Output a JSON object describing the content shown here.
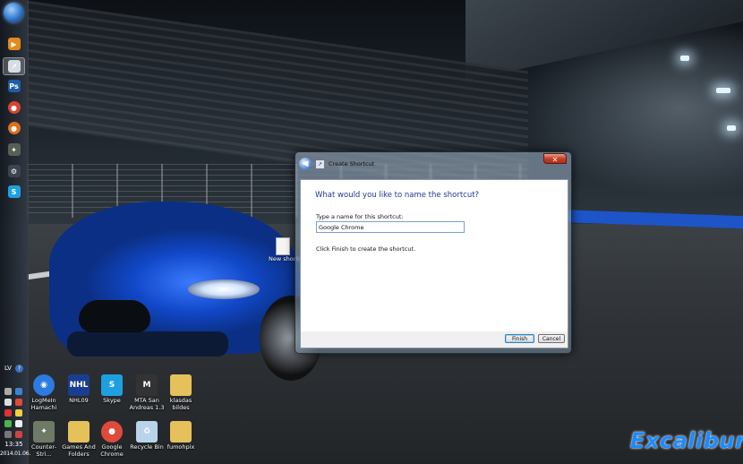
{
  "desktop": {
    "brand_text": "Excalibur",
    "icons": [
      {
        "label": "LogMeIn Hamachi",
        "icon": "hamachi-icon",
        "color": "#2b7be0"
      },
      {
        "label": "NHL09",
        "icon": "nhl09-icon",
        "color": "#1a3d8f"
      },
      {
        "label": "Skype",
        "icon": "skype-icon",
        "color": "#1ea0e0"
      },
      {
        "label": "MTA San Andreas 1.3",
        "icon": "mta-icon",
        "color": "#333333"
      },
      {
        "label": "klasdas bildes",
        "icon": "folder-icon",
        "color": "#e4c15a"
      },
      {
        "label": "Counter-Stri...",
        "icon": "counter-strike-icon",
        "color": "#6f7a66"
      },
      {
        "label": "Games And Folders",
        "icon": "folder-icon",
        "color": "#e4c15a"
      },
      {
        "label": "Google Chrome",
        "icon": "chrome-icon",
        "color": "#e04a3a"
      },
      {
        "label": "Recycle Bin",
        "icon": "recycle-bin-icon",
        "color": "#b9d4ea"
      },
      {
        "label": "fumohpix",
        "icon": "folder-icon",
        "color": "#e4c15a"
      }
    ],
    "hidden_icon_label": "New shortc"
  },
  "taskbar": {
    "buttons": [
      {
        "name": "media-player",
        "icon": "media-player-icon",
        "glyph": "▶",
        "color": "#e38a1d"
      },
      {
        "name": "shortcut",
        "icon": "shortcut-icon",
        "glyph": "↗",
        "color": "#d7dde5"
      },
      {
        "name": "photoshop",
        "icon": "photoshop-icon",
        "glyph": "Ps",
        "color": "#1d5ea8"
      },
      {
        "name": "chrome",
        "icon": "chrome-icon",
        "glyph": "●",
        "color": "#d9432f"
      },
      {
        "name": "firefox",
        "icon": "firefox-icon",
        "glyph": "●",
        "color": "#e06f1b"
      },
      {
        "name": "counter-strike",
        "icon": "counter-strike-icon",
        "glyph": "✦",
        "color": "#585f54"
      },
      {
        "name": "steam",
        "icon": "steam-icon",
        "glyph": "⚙",
        "color": "#3d4450"
      },
      {
        "name": "skype",
        "icon": "skype-icon",
        "glyph": "S",
        "color": "#1ea0e0"
      }
    ],
    "language": "LV",
    "clock_time": "13:35",
    "clock_date": "2014.01.06."
  },
  "dialog": {
    "title": "Create Shortcut",
    "heading": "What would you like to name the shortcut?",
    "field_label": "Type a name for this shortcut:",
    "field_value": "Google Chrome",
    "note": "Click Finish to create the shortcut.",
    "finish_label": "Finish",
    "cancel_label": "Cancel",
    "close_glyph": "✕",
    "back_glyph": "◀"
  }
}
